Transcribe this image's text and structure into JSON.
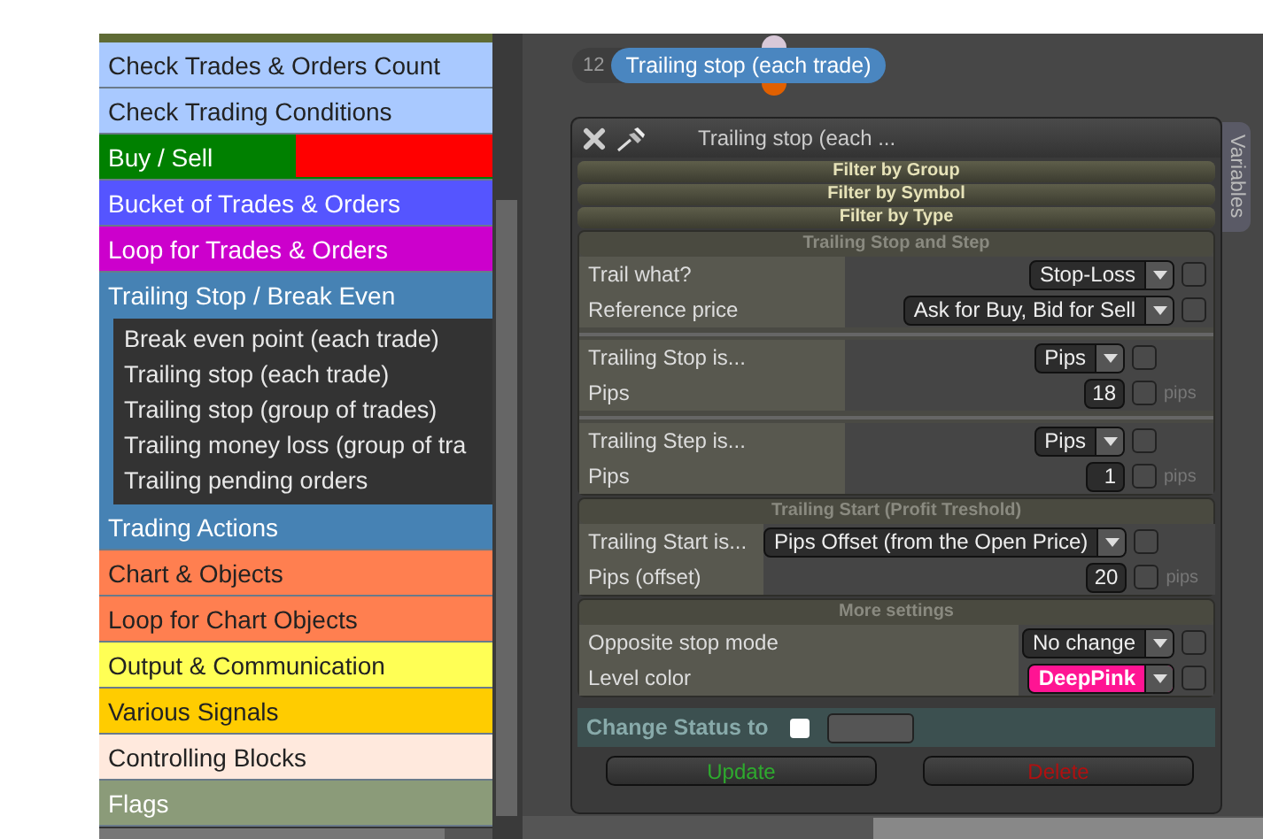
{
  "categories": [
    {
      "label": "Check Trades & Orders Count",
      "color": "#a9c9ff",
      "expanded": false
    },
    {
      "label": "Check Trading Conditions",
      "color": "#a9c9ff",
      "expanded": false
    },
    {
      "label": "Buy / Sell",
      "color": "#008000",
      "accent": {
        "color": "#ff0000"
      },
      "expanded": false
    },
    {
      "label": "Bucket of Trades & Orders",
      "color": "#5555ff",
      "expanded": false
    },
    {
      "label": "Loop for Trades & Orders",
      "color": "#cc00cc",
      "expanded": false
    },
    {
      "label": "Trailing Stop / Break Even",
      "color": "#4682b4",
      "expanded": true,
      "children": [
        "Break even point (each trade)",
        "Trailing stop (each trade)",
        "Trailing stop (group of trades)",
        "Trailing money loss (group of tra",
        "Trailing pending orders"
      ]
    },
    {
      "label": "Trading Actions",
      "color": "#4682b4",
      "expanded": false
    },
    {
      "label": "Chart & Objects",
      "color": "#ff7f50",
      "expanded": false
    },
    {
      "label": "Loop for Chart Objects",
      "color": "#ff7f50",
      "expanded": false
    },
    {
      "label": "Output & Communication",
      "color": "#ffff55",
      "expanded": false
    },
    {
      "label": "Various Signals",
      "color": "#ffcc00",
      "expanded": false
    },
    {
      "label": "Controlling Blocks",
      "color": "#ffe9dd",
      "expanded": false
    },
    {
      "label": "Flags",
      "color": "#8b9b79",
      "expanded": false
    }
  ],
  "block": {
    "number": "12",
    "label": "Trailing stop (each trade)"
  },
  "panel": {
    "title": "Trailing stop (each ...",
    "side_tab": "Variables",
    "sections": [
      {
        "title": "Filter by Group",
        "expanded": false
      },
      {
        "title": "Filter by Symbol",
        "expanded": false
      },
      {
        "title": "Filter by Type",
        "expanded": false
      },
      {
        "title": "Trailing Stop and Step",
        "expanded": true,
        "groups": [
          [
            {
              "label": "Trail what?",
              "kind": "select",
              "value": "Stop-Loss",
              "checked": false
            },
            {
              "label": "Reference price",
              "kind": "select",
              "value": "Ask for Buy, Bid for Sell",
              "checked": false
            }
          ],
          [
            {
              "label": "Trailing Stop is...",
              "kind": "select",
              "value": "Pips",
              "checked": false
            },
            {
              "label": "Pips",
              "kind": "number",
              "value": "18",
              "unit": "pips",
              "checked": false
            }
          ],
          [
            {
              "label": "Trailing Step is...",
              "kind": "select",
              "value": "Pips",
              "checked": false
            },
            {
              "label": "Pips",
              "kind": "number",
              "value": "1",
              "unit": "pips",
              "checked": false
            }
          ]
        ]
      },
      {
        "title": "Trailing Start (Profit Treshold)",
        "expanded": true,
        "groups": [
          [
            {
              "label": "Trailing Start is...",
              "kind": "select",
              "value": "Pips Offset (from the Open Price)",
              "checked": false
            },
            {
              "label": "Pips (offset)",
              "kind": "number",
              "value": "20",
              "unit": "pips",
              "checked": false
            }
          ]
        ]
      },
      {
        "title": "More settings",
        "expanded": true,
        "groups": [
          [
            {
              "label": "Opposite stop mode",
              "kind": "select",
              "value": "No change",
              "checked": false
            },
            {
              "label": "Level color",
              "kind": "select",
              "value": "DeepPink",
              "color": "#ff1493",
              "checked": false
            }
          ]
        ]
      }
    ],
    "status": {
      "label": "Change Status to",
      "checked": false
    },
    "buttons": [
      {
        "label": "Update",
        "kind": "update"
      },
      {
        "label": "Delete",
        "kind": "delete"
      }
    ]
  }
}
